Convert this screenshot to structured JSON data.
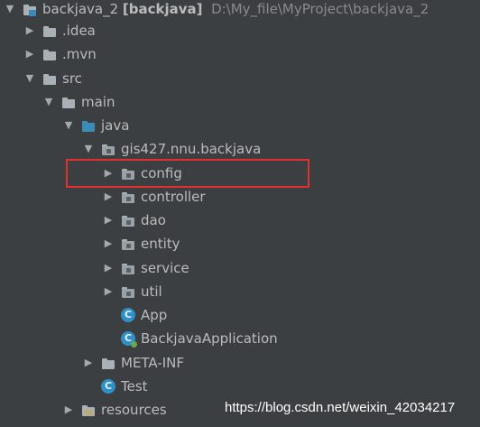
{
  "colors": {
    "background": "#3c3f41",
    "text": "#bbbbbb",
    "path_text": "#8a8a8a",
    "highlight_border": "#e2302d",
    "source_folder": "#3b8bb8",
    "class_icon": "#2f8fc7"
  },
  "tree": {
    "root": {
      "name": "backjava_2",
      "module": "[backjava]",
      "path": "D:\\My_file\\MyProject\\backjava_2",
      "icon": "module-folder-icon"
    },
    "idea": {
      "label": ".idea",
      "icon": "folder-icon"
    },
    "mvn": {
      "label": ".mvn",
      "icon": "folder-icon"
    },
    "src": {
      "label": "src",
      "icon": "folder-icon"
    },
    "main": {
      "label": "main",
      "icon": "folder-icon"
    },
    "java": {
      "label": "java",
      "icon": "source-folder-icon"
    },
    "package": {
      "label": "gis427.nnu.backjava",
      "icon": "package-icon"
    },
    "config": {
      "label": "config",
      "icon": "package-icon"
    },
    "controller": {
      "label": "controller",
      "icon": "package-icon"
    },
    "dao": {
      "label": "dao",
      "icon": "package-icon"
    },
    "entity": {
      "label": "entity",
      "icon": "package-icon"
    },
    "service": {
      "label": "service",
      "icon": "package-icon"
    },
    "util": {
      "label": "util",
      "icon": "package-icon"
    },
    "app": {
      "label": "App",
      "icon": "class-icon",
      "glyph": "C"
    },
    "backjava_application": {
      "label": "BackjavaApplication",
      "icon": "spring-boot-class-icon",
      "glyph": "C"
    },
    "meta_inf": {
      "label": "META-INF",
      "icon": "folder-icon"
    },
    "test": {
      "label": "Test",
      "icon": "class-icon",
      "glyph": "C"
    },
    "resources": {
      "label": "resources",
      "icon": "resources-folder-icon"
    }
  },
  "watermark": "https://blog.csdn.net/weixin_42034217"
}
